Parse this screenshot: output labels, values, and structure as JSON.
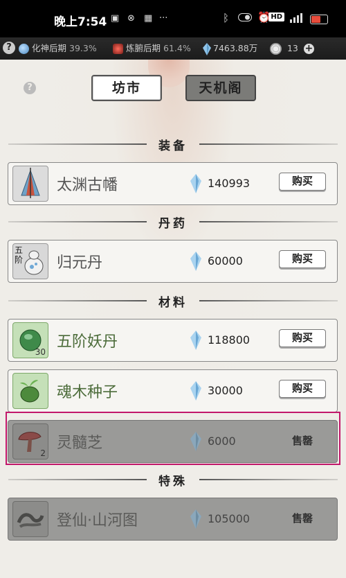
{
  "status_bar": {
    "time": "晚上7:54",
    "hd_badge": "HD"
  },
  "resource_bar": {
    "help_icon": "?",
    "realm1_name": "化神后期",
    "realm1_pct": "39.3%",
    "realm2_name": "炼腑后期",
    "realm2_pct": "61.4%",
    "stones": "7463.88万",
    "tokens": "13",
    "plus": "+"
  },
  "top_help": "?",
  "tabs": [
    {
      "label": "坊市",
      "active": true
    },
    {
      "label": "天机阁",
      "active": false
    }
  ],
  "sections": {
    "equipment": "装备",
    "pills": "丹药",
    "materials": "材料",
    "special": "特殊"
  },
  "items": [
    {
      "name": "太渊古幡",
      "price": "140993",
      "action": "购买",
      "icon": "banner-icon",
      "grade": "",
      "count": ""
    },
    {
      "name": "归元丹",
      "price": "60000",
      "action": "购买",
      "icon": "pill-gourd-icon",
      "grade": "五阶",
      "count": ""
    },
    {
      "name": "五阶妖丹",
      "price": "118800",
      "action": "购买",
      "icon": "demon-core-icon",
      "grade": "",
      "count": "30"
    },
    {
      "name": "魂木种子",
      "price": "30000",
      "action": "购买",
      "icon": "seed-icon",
      "grade": "",
      "count": ""
    },
    {
      "name": "灵髓芝",
      "price": "6000",
      "action": "售罄",
      "icon": "mushroom-icon",
      "grade": "",
      "count": "2"
    },
    {
      "name": "登仙·山河图",
      "price": "105000",
      "action": "售罄",
      "icon": "scroll-icon",
      "grade": "",
      "count": ""
    }
  ],
  "colors": {
    "highlight_border": "#c2186b",
    "green_text": "#4c6c3a",
    "sold_card": "#9a9a98"
  }
}
